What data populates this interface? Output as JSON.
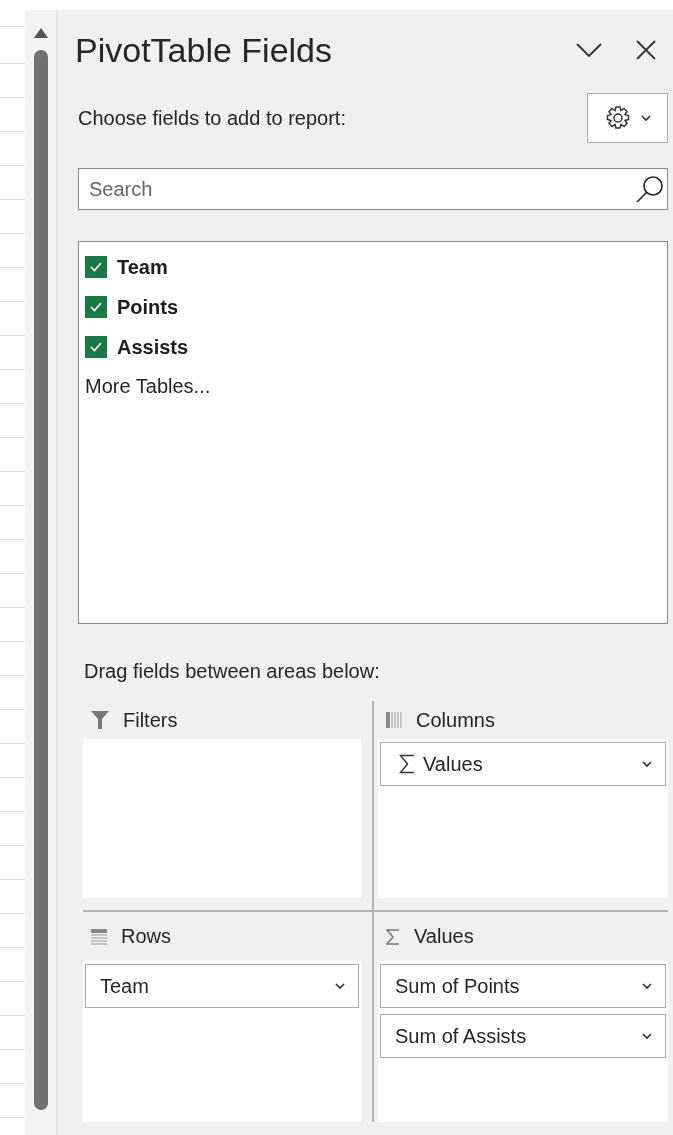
{
  "panel": {
    "title": "PivotTable Fields",
    "prompt": "Choose fields to add to report:",
    "search": {
      "placeholder": "Search"
    },
    "fields": [
      {
        "label": "Team",
        "checked": true
      },
      {
        "label": "Points",
        "checked": true
      },
      {
        "label": "Assists",
        "checked": true
      }
    ],
    "more_tables": "More Tables...",
    "areas_prompt": "Drag fields between areas below:",
    "areas": [
      {
        "kind": "filters",
        "label": "Filters"
      },
      {
        "kind": "columns",
        "label": "Columns",
        "items": [
          {
            "kind": "sigma",
            "label": "Values"
          }
        ]
      },
      {
        "kind": "rows",
        "label": "Rows",
        "items": [
          {
            "kind": "field",
            "label": "Team"
          }
        ]
      },
      {
        "kind": "values",
        "label": "Values",
        "items": [
          {
            "kind": "field",
            "label": "Sum of Points"
          },
          {
            "kind": "field",
            "label": "Sum of Assists"
          }
        ]
      }
    ]
  }
}
